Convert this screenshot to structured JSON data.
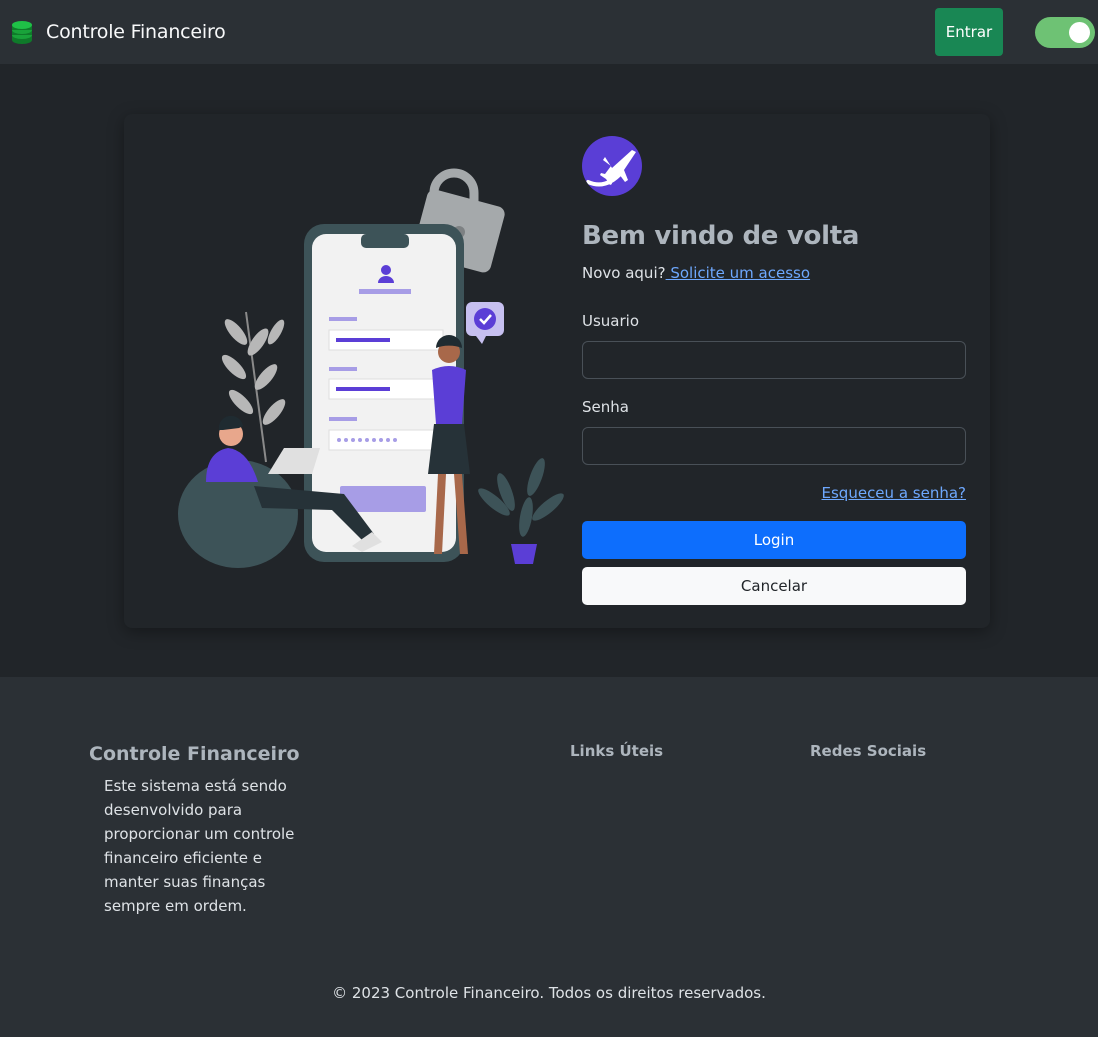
{
  "navbar": {
    "brand_icon": "coins-stack-icon",
    "brand_title": "Controle Financeiro",
    "enter_label": "Entrar",
    "theme_toggle_on": true,
    "accent_green": "#198754"
  },
  "login": {
    "logo_icon": "airplane-icon",
    "heading": "Bem vindo de volta",
    "subtext": "Novo aqui?",
    "request_link": " Solicite um acesso",
    "username_label": "Usuario",
    "username_value": "",
    "password_label": "Senha",
    "password_value": "",
    "forgot_link": "Esqueceu a senha?",
    "login_label": "Login",
    "cancel_label": "Cancelar",
    "primary_color": "#0d6efd"
  },
  "footer": {
    "title": "Controle Financeiro",
    "description": "Este sistema está sendo desenvolvido para proporcionar um controle financeiro eficiente e manter suas finanças sempre em ordem.",
    "links_heading": "Links Úteis",
    "social_heading": "Redes Sociais",
    "copyright": "© 2023 Controle Financeiro. Todos os direitos reservados."
  }
}
